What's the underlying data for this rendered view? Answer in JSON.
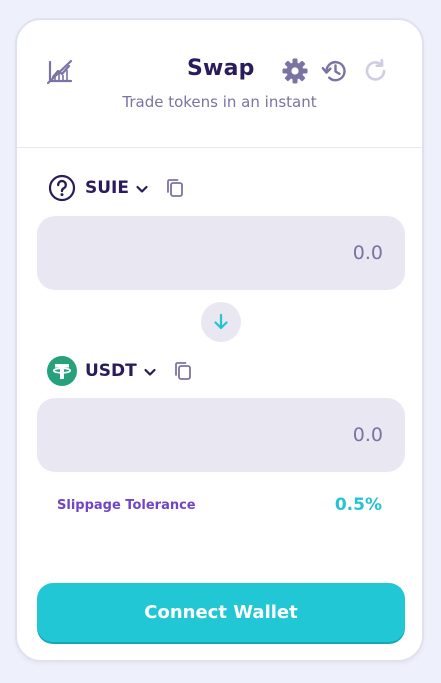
{
  "header": {
    "title": "Swap",
    "subtitle": "Trade tokens in an instant",
    "icons": {
      "chart_toggle": "chart-disabled-icon",
      "settings": "gear-icon",
      "history": "history-icon",
      "refresh": "refresh-icon"
    }
  },
  "from_token": {
    "symbol": "SUIE",
    "icon": "question-mark-icon",
    "amount_placeholder": "0.0"
  },
  "swap_direction": {
    "icon": "arrow-down-icon"
  },
  "to_token": {
    "symbol": "USDT",
    "icon": "tether-icon",
    "amount_placeholder": "0.0"
  },
  "slippage": {
    "label": "Slippage Tolerance",
    "value": "0.5%"
  },
  "connect_button": {
    "label": "Connect Wallet"
  },
  "colors": {
    "primary_text": "#2a1c5a",
    "muted_text": "#7a73a3",
    "input_bg": "#e9e7f1",
    "accent_teal": "#22c7d6",
    "accent_purple": "#7046c6",
    "tether_green": "#26a17b",
    "background": "#eef1fb"
  }
}
